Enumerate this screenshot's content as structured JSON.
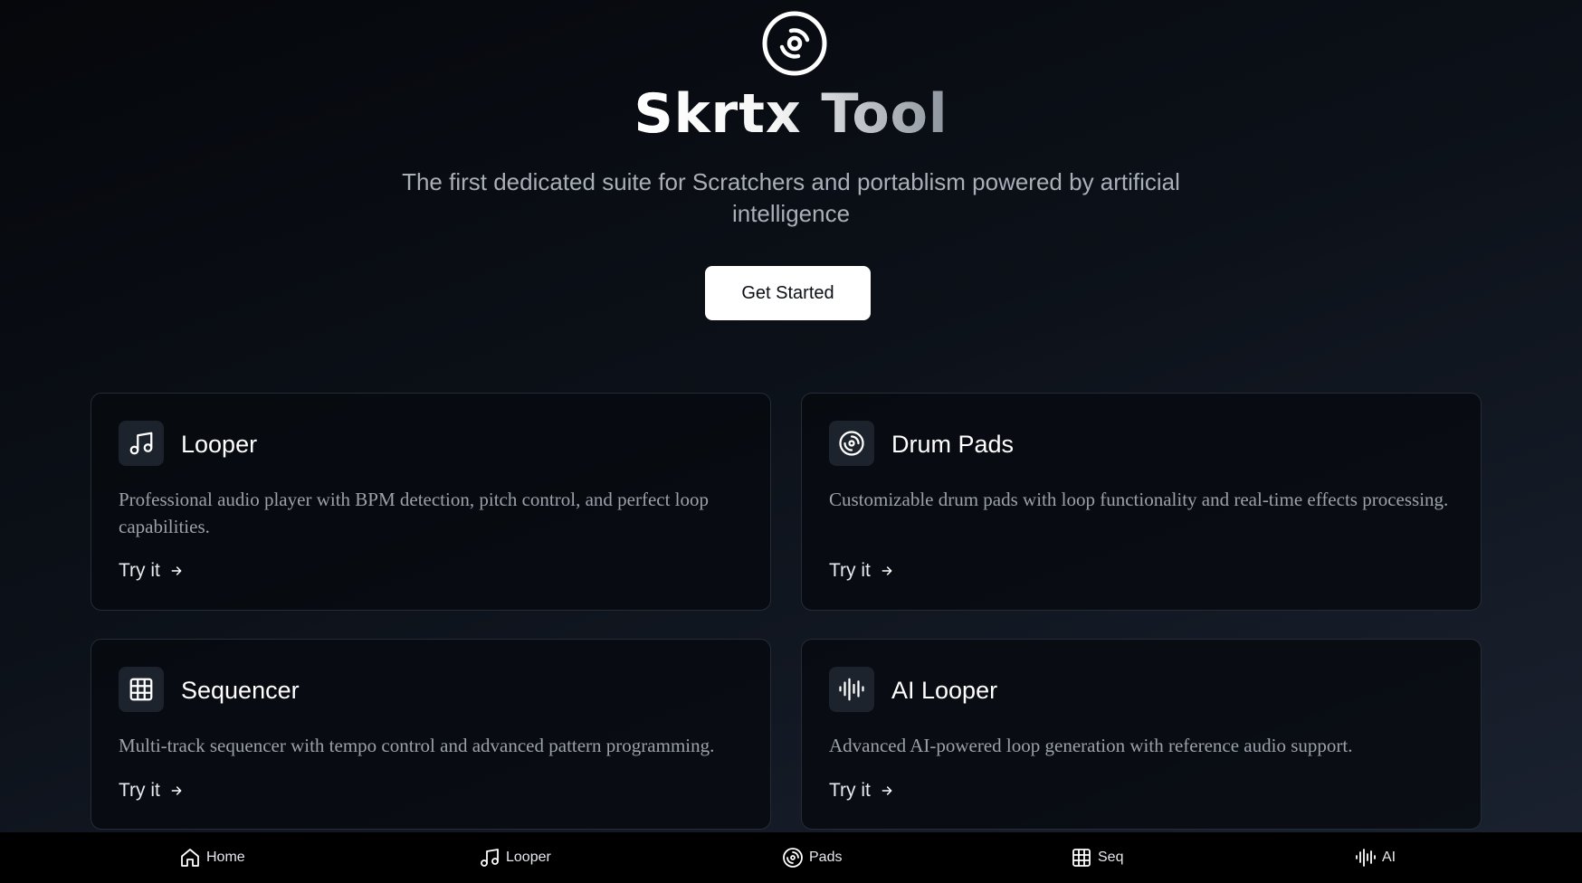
{
  "hero": {
    "logo_icon": "disc-icon",
    "title": "Skrtx Tool",
    "tagline": "The first dedicated suite for Scratchers and portablism powered by artificial intelligence",
    "cta_label": "Get Started"
  },
  "cards": [
    {
      "icon": "music-note-icon",
      "title": "Looper",
      "description": "Professional audio player with BPM detection, pitch control, and perfect loop capabilities.",
      "link_label": "Try it"
    },
    {
      "icon": "disc-icon",
      "title": "Drum Pads",
      "description": "Customizable drum pads with loop functionality and real-time effects processing.",
      "link_label": "Try it"
    },
    {
      "icon": "grid-icon",
      "title": "Sequencer",
      "description": "Multi-track sequencer with tempo control and advanced pattern programming.",
      "link_label": "Try it"
    },
    {
      "icon": "waveform-icon",
      "title": "AI Looper",
      "description": "Advanced AI-powered loop generation with reference audio support.",
      "link_label": "Try it"
    }
  ],
  "bottom_nav": [
    {
      "icon": "home-icon",
      "label": "Home"
    },
    {
      "icon": "music-note-icon",
      "label": "Looper"
    },
    {
      "icon": "disc-icon",
      "label": "Pads"
    },
    {
      "icon": "grid-icon",
      "label": "Seq"
    },
    {
      "icon": "waveform-icon",
      "label": "AI"
    }
  ],
  "colors": {
    "background_start": "#05070b",
    "background_end": "#1b2230",
    "card_border": "#262c36",
    "icon_box": "#1d232d",
    "muted_text": "#9aa1ab",
    "cta_background": "#ffffff"
  }
}
